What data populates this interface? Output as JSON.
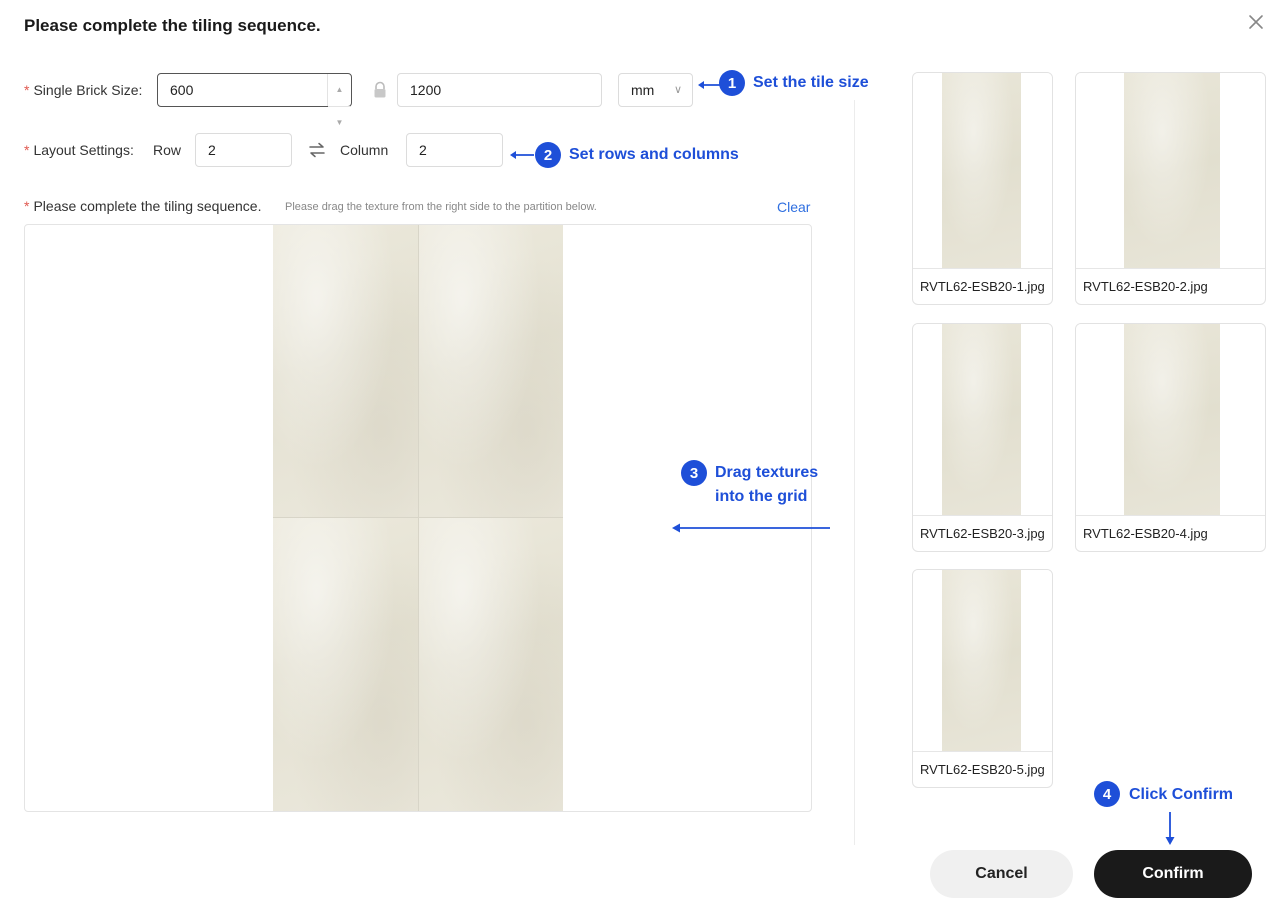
{
  "dialog": {
    "title": "Please complete the tiling sequence.",
    "close_icon": "close-icon"
  },
  "brick_size": {
    "label": "Single Brick Size",
    "colon": ":",
    "width_value": "600",
    "height_value": "1200",
    "lock_icon": "lock-icon",
    "unit": "mm"
  },
  "layout": {
    "label": "Layout Settings",
    "colon": ":",
    "row_label": "Row",
    "row_value": "2",
    "swap_icon": "swap-icon",
    "column_label": "Column",
    "column_value": "2"
  },
  "sequence": {
    "label": "Please complete the tiling sequence.",
    "hint": "Please drag the texture from the right side to the partition below.",
    "clear": "Clear"
  },
  "textures": [
    {
      "name": "RVTL62-ESB20-1.jpg"
    },
    {
      "name": "RVTL62-ESB20-2.jpg"
    },
    {
      "name": "RVTL62-ESB20-3.jpg"
    },
    {
      "name": "RVTL62-ESB20-4.jpg"
    },
    {
      "name": "RVTL62-ESB20-5.jpg"
    }
  ],
  "callouts": {
    "c1_num": "1",
    "c1_text": "Set the tile size",
    "c2_num": "2",
    "c2_text": "Set rows and columns",
    "c3_num": "3",
    "c3_line1": "Drag textures",
    "c3_line2": "into the grid",
    "c4_num": "4",
    "c4_text": "Click Confirm"
  },
  "buttons": {
    "cancel": "Cancel",
    "confirm": "Confirm"
  },
  "colors": {
    "accent_blue": "#1e4fd8",
    "link_blue": "#2f6fe0",
    "confirm_bg": "#1a1a1a",
    "required_red": "#e0584f"
  }
}
